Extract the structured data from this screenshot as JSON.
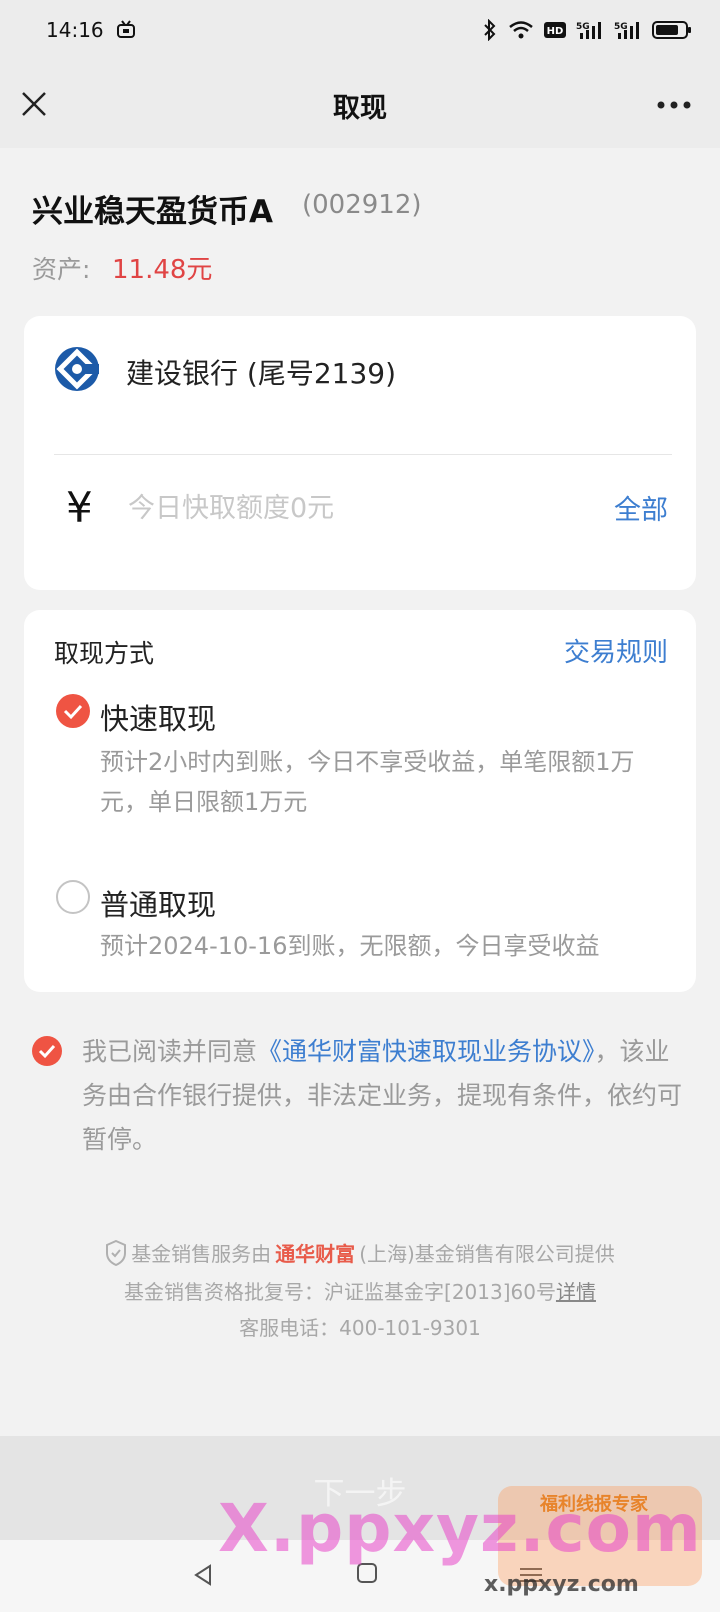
{
  "status": {
    "time": "14:16"
  },
  "nav": {
    "title": "取现"
  },
  "fund": {
    "name": "兴业稳天盈货币A",
    "code": "(002912)",
    "asset_label": "资产:",
    "asset_value": "11.48元"
  },
  "bank": {
    "name": "建设银行 (尾号2139)",
    "currency_symbol": "¥",
    "amount_placeholder": "今日快取额度0元",
    "all_label": "全部"
  },
  "method": {
    "title": "取现方式",
    "rules_label": "交易规则",
    "options": [
      {
        "label": "快速取现",
        "desc": "预计2小时内到账，今日不享受收益，单笔限额1万元，单日限额1万元",
        "checked": true
      },
      {
        "label": "普通取现",
        "desc": "预计2024-10-16到账，无限额，今日享受收益",
        "checked": false
      }
    ]
  },
  "agreement": {
    "prefix": "我已阅读并同意",
    "link": "《通华财富快速取现业务协议》",
    "suffix": "，该业务由合作银行提供，非法定业务，提现有条件，依约可暂停。"
  },
  "footer": {
    "line1_prefix": "基金销售服务由",
    "line1_brand": "通华财富",
    "line1_suffix": "(上海)基金销售有限公司提供",
    "line2": "基金销售资格批复号：沪证监基金字[2013]60号",
    "line2_link": "详情",
    "line3": "客服电话：400-101-9301"
  },
  "next_button": {
    "label": "下一步"
  },
  "watermark": {
    "main": "X.ppxyz.com",
    "badge": "福利线报专家",
    "url": "x.ppxyz.com"
  },
  "colors": {
    "accent_red": "#ef5443",
    "link_blue": "#3d7ed0",
    "asset_red": "#e04444"
  }
}
